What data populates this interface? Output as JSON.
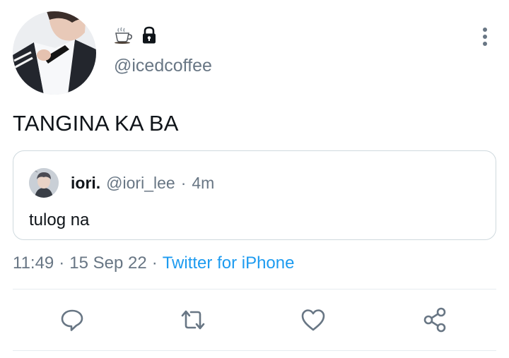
{
  "tweet": {
    "author": {
      "display_name_icons": [
        "coffee-cup-icon",
        "lock-icon"
      ],
      "handle": "@icedcoffee"
    },
    "text": "TANGINA KA BA",
    "quoted": {
      "name": "iori.",
      "handle": "@iori_lee",
      "separator": "·",
      "time": "4m",
      "text": "tulog na"
    },
    "meta": {
      "time": "11:49",
      "separator_1": "·",
      "date": "15 Sep 22",
      "separator_2": "·",
      "source": "Twitter for iPhone"
    }
  },
  "actions": [
    "reply-icon",
    "retweet-icon",
    "like-icon",
    "share-icon"
  ],
  "colors": {
    "text": "#0f1419",
    "secondary": "#687684",
    "link": "#1d9bf0",
    "border": "#cfd9de",
    "divider": "#e6ecf0"
  }
}
